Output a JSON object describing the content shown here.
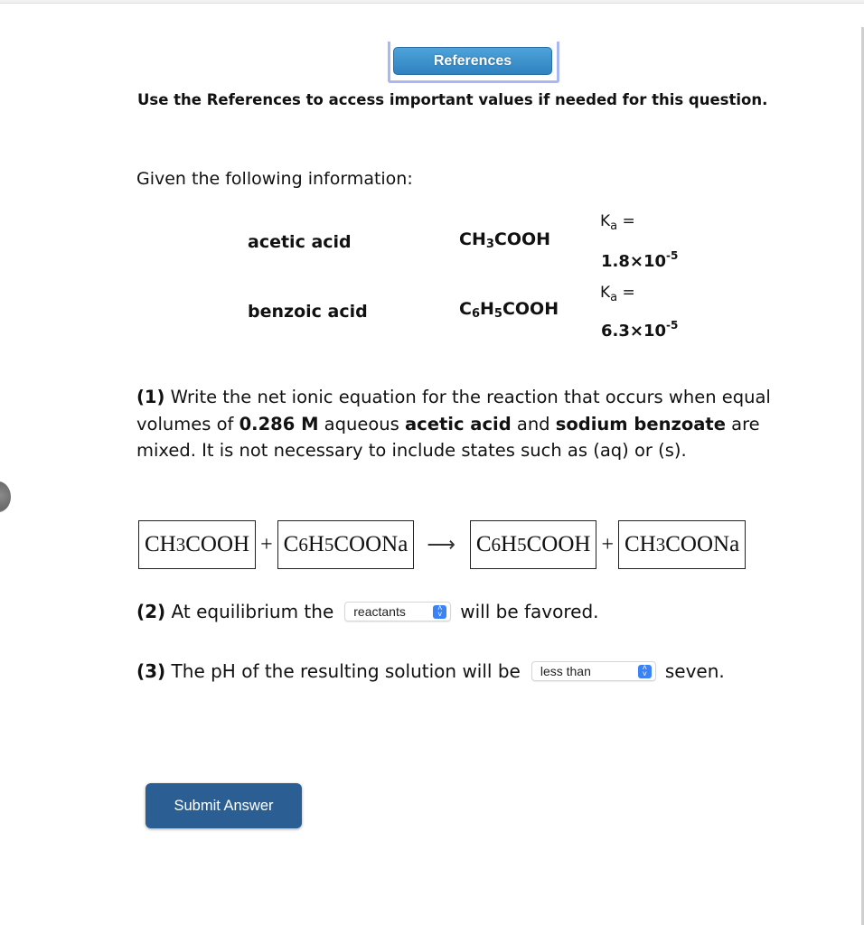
{
  "references_button": "References",
  "instruction": "Use the References to access important values if needed for this question.",
  "given_label": "Given the following information:",
  "acids": [
    {
      "name": "acetic acid",
      "formula": {
        "p1": "CH",
        "s1": "3",
        "p2": "COOH"
      },
      "ka_label": "K",
      "ka_sub": "a",
      "ka_eq": " =",
      "ka_value": "1.8×10",
      "ka_exp": "-5"
    },
    {
      "name": "benzoic acid",
      "formula": {
        "p1": "C",
        "s1": "6",
        "p2": "H",
        "s2": "5",
        "p3": "COOH"
      },
      "ka_label": "K",
      "ka_sub": "a",
      "ka_eq": " =",
      "ka_value": "6.3×10",
      "ka_exp": "-5"
    }
  ],
  "question1": {
    "num": "(1)",
    "t1": " Write the net ionic equation for the reaction that occurs when equal volumes of ",
    "b1": "0.286 M",
    "t2": " aqueous ",
    "b2": "acetic acid",
    "t3": " and ",
    "b3": "sodium benzoate",
    "t4": " are mixed. It is not necessary to include states such as (aq) or (s)."
  },
  "equation": {
    "r1": {
      "p1": "CH",
      "s1": "3",
      "p2": "COOH"
    },
    "r2": {
      "p1": "C",
      "s1": "6",
      "p2": "H",
      "s2": "5",
      "p3": "COONa"
    },
    "p1": {
      "p1": "C",
      "s1": "6",
      "p2": "H",
      "s2": "5",
      "p3": "COOH"
    },
    "p2": {
      "p1": "CH",
      "s1": "3",
      "p2": "COONa"
    },
    "plus": "+",
    "arrow": "⟶"
  },
  "question2": {
    "num": "(2)",
    "before": " At equilibrium the",
    "selected": "reactants",
    "after": "will be favored."
  },
  "question3": {
    "num": "(3)",
    "before": " The pH of the resulting solution will be",
    "selected": "less than",
    "after": "seven."
  },
  "select_icon": {
    "up": "˄",
    "down": "˅"
  },
  "submit_button": "Submit Answer"
}
